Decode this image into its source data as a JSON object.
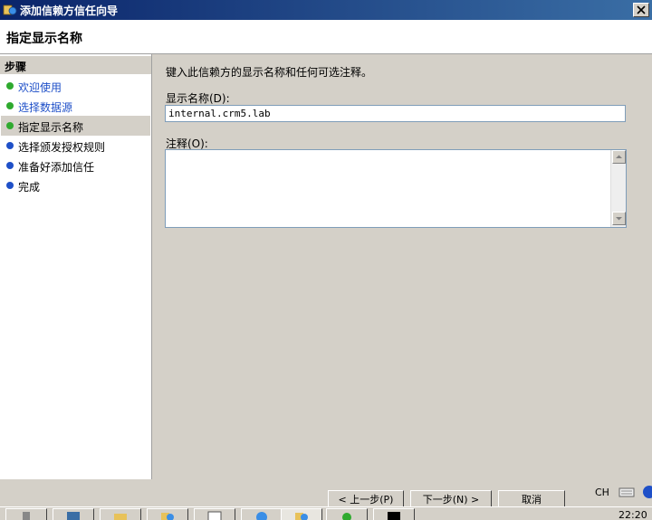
{
  "window": {
    "title": "添加信赖方信任向导"
  },
  "header": {
    "title": "指定显示名称"
  },
  "steps": {
    "title": "步骤",
    "items": [
      {
        "label": "欢迎使用",
        "state": "done"
      },
      {
        "label": "选择数据源",
        "state": "done"
      },
      {
        "label": "指定显示名称",
        "state": "current"
      },
      {
        "label": "选择颁发授权规则",
        "state": "todo"
      },
      {
        "label": "准备好添加信任",
        "state": "todo"
      },
      {
        "label": "完成",
        "state": "todo"
      }
    ]
  },
  "content": {
    "intro": "键入此信赖方的显示名称和任何可选注释。",
    "name_label": "显示名称(D):",
    "name_value": "internal.crm5.lab",
    "notes_label": "注释(O):"
  },
  "buttons": {
    "prev": "< 上一步(P)",
    "next": "下一步(N) >",
    "cancel": "取消"
  },
  "tray": {
    "lang": "CH",
    "clock": "22:20"
  },
  "colors": {
    "done": "#2faa2f",
    "todo": "#1f50c8",
    "title_bar": "#0a246a"
  },
  "icons": [
    "app-icon",
    "close-icon",
    "keyboard-icon",
    "help-icon"
  ]
}
